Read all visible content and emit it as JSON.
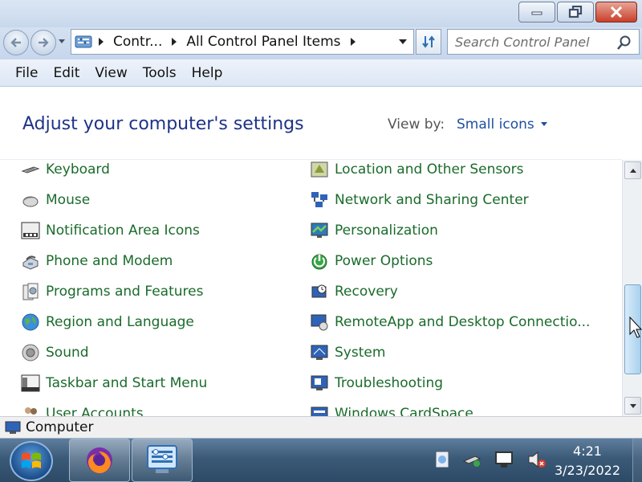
{
  "window": {
    "buttons": {
      "minimize": "minimize",
      "restore": "restore",
      "close": "close"
    }
  },
  "address": {
    "crumbs": [
      "Contr...",
      "All Control Panel Items"
    ],
    "search_placeholder": "Search Control Panel"
  },
  "menu": [
    "File",
    "Edit",
    "View",
    "Tools",
    "Help"
  ],
  "page": {
    "heading": "Adjust your computer's settings",
    "view_by_label": "View by:",
    "view_by_value": "Small icons"
  },
  "items_left": [
    {
      "label": "Keyboard",
      "icon": "keyboard-icon"
    },
    {
      "label": "Mouse",
      "icon": "mouse-icon"
    },
    {
      "label": "Notification Area Icons",
      "icon": "notification-area-icon"
    },
    {
      "label": "Phone and Modem",
      "icon": "phone-modem-icon"
    },
    {
      "label": "Programs and Features",
      "icon": "programs-icon"
    },
    {
      "label": "Region and Language",
      "icon": "globe-icon"
    },
    {
      "label": "Sound",
      "icon": "speaker-icon"
    },
    {
      "label": "Taskbar and Start Menu",
      "icon": "taskbar-icon"
    },
    {
      "label": "User Accounts",
      "icon": "users-icon"
    }
  ],
  "items_right": [
    {
      "label": "Location and Other Sensors",
      "icon": "sensor-icon"
    },
    {
      "label": "Network and Sharing Center",
      "icon": "network-icon"
    },
    {
      "label": "Personalization",
      "icon": "personalization-icon"
    },
    {
      "label": "Power Options",
      "icon": "power-icon"
    },
    {
      "label": "Recovery",
      "icon": "recovery-icon"
    },
    {
      "label": "RemoteApp and Desktop Connectio...",
      "icon": "remoteapp-icon"
    },
    {
      "label": "System",
      "icon": "system-icon"
    },
    {
      "label": "Troubleshooting",
      "icon": "troubleshooting-icon"
    },
    {
      "label": "Windows CardSpace",
      "icon": "cardspace-icon"
    }
  ],
  "status": {
    "label": "Computer"
  },
  "taskbar": {
    "apps": [
      "Firefox",
      "Control Panel"
    ],
    "time": "4:21",
    "date": "3/23/2022"
  },
  "colors": {
    "link": "#1a6b2b",
    "heading": "#1e3287",
    "accent": "#1e50a2"
  }
}
